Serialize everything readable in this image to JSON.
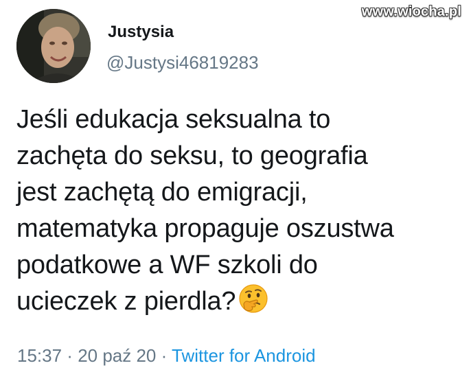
{
  "watermark": "www.wiocha.pl",
  "author": {
    "name": "Justysia",
    "handle": "@Justysi46819283"
  },
  "tweet": {
    "lines": [
      "Jeśli edukacja seksualna to",
      "zachęta do seksu, to geografia",
      "jest zachętą do emigracji,",
      "matematyka propaguje oszustwa",
      "podatkowe a WF szkoli do",
      "ucieczek z pierdla?"
    ],
    "emoji": "thinking-face-icon"
  },
  "meta": {
    "time": "15:37",
    "separator": " · ",
    "date": "20 paź 20",
    "source": "Twitter for Android"
  },
  "colors": {
    "text": "#14171a",
    "secondary": "#657786",
    "link": "#1b95e0"
  }
}
